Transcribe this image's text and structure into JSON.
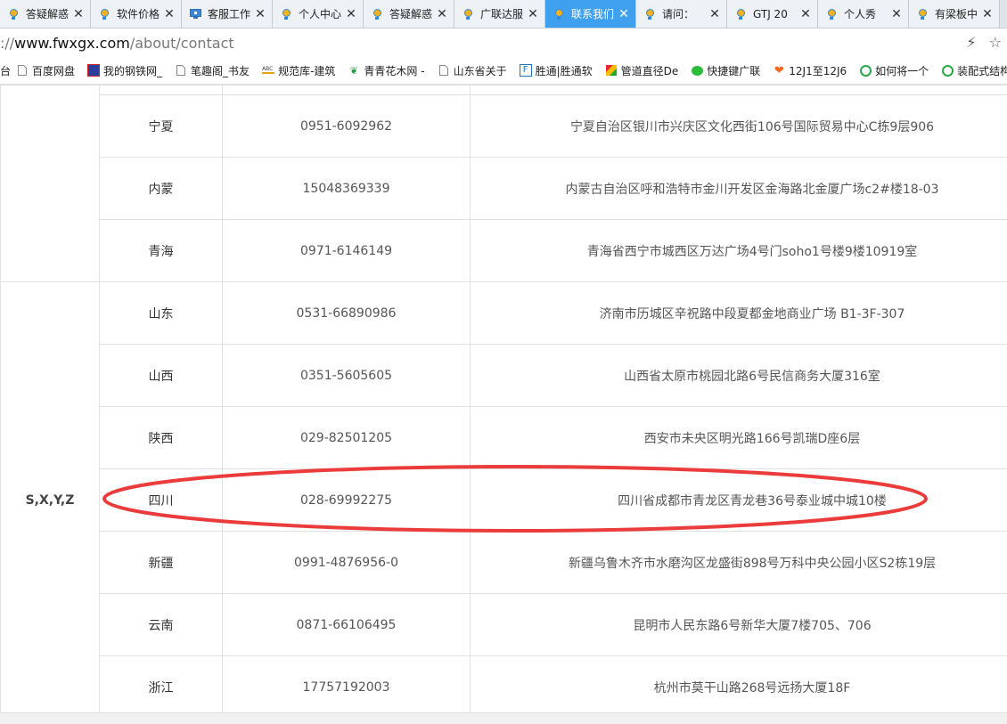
{
  "tabs": [
    {
      "label": "答疑解惑",
      "icon": "bulb-icon",
      "active": false
    },
    {
      "label": "软件价格",
      "icon": "bulb-icon",
      "active": false
    },
    {
      "label": "客服工作",
      "icon": "monitor-icon",
      "active": false
    },
    {
      "label": "个人中心",
      "icon": "bulb-icon",
      "active": false
    },
    {
      "label": "答疑解惑",
      "icon": "bulb-icon",
      "active": false
    },
    {
      "label": "广联达服",
      "icon": "bulb-icon",
      "active": false
    },
    {
      "label": "联系我们",
      "icon": "bulb-icon",
      "active": true
    },
    {
      "label": "请问：",
      "icon": "bulb-icon",
      "active": false
    },
    {
      "label": "GTJ 20",
      "icon": "bulb-icon",
      "active": false
    },
    {
      "label": "个人秀",
      "icon": "bulb-icon",
      "active": false
    },
    {
      "label": "有梁板中",
      "icon": "bulb-icon",
      "active": false
    }
  ],
  "address": {
    "scheme": "://",
    "domain": "www.fwxgx.com",
    "path": "/about/contact"
  },
  "bookmarks": [
    {
      "label": "台",
      "icon": ""
    },
    {
      "label": "百度网盘",
      "icon": "page-icon"
    },
    {
      "label": "我的钢铁网_",
      "icon": "steel-icon"
    },
    {
      "label": "笔趣阁_书友",
      "icon": "page-icon"
    },
    {
      "label": "规范库-建筑",
      "icon": "ruler-icon"
    },
    {
      "label": "青青花木网 -",
      "icon": "leaf-icon"
    },
    {
      "label": "山东省关于",
      "icon": "page-icon"
    },
    {
      "label": "胜通|胜通软",
      "icon": "f-icon"
    },
    {
      "label": "管道直径De",
      "icon": "puzzle-icon"
    },
    {
      "label": "快捷键广联",
      "icon": "wechat-icon"
    },
    {
      "label": "12J1至12J6",
      "icon": "heart-icon"
    },
    {
      "label": "如何将一个",
      "icon": "circle-icon"
    },
    {
      "label": "装配式结构",
      "icon": "circle-icon"
    }
  ],
  "groups": [
    {
      "name": "",
      "rows": [
        {
          "province": "",
          "phone": "",
          "address": ""
        },
        {
          "province": "宁夏",
          "phone": "0951-6092962",
          "address": "宁夏自治区银川市兴庆区文化西街106号国际贸易中心C栋9层906"
        },
        {
          "province": "内蒙",
          "phone": "15048369339",
          "address": "内蒙古自治区呼和浩特市金川开发区金海路北金厦广场c2#楼18-03"
        },
        {
          "province": "青海",
          "phone": "0971-6146149",
          "address": "青海省西宁市城西区万达广场4号门soho1号楼9楼10919室"
        }
      ]
    },
    {
      "name": "S,X,Y,Z",
      "rows": [
        {
          "province": "山东",
          "phone": "0531-66890986",
          "address": "济南市历城区辛祝路中段夏都金地商业广场 B1-3F-307"
        },
        {
          "province": "山西",
          "phone": "0351-5605605",
          "address": "山西省太原市桃园北路6号民信商务大厦316室"
        },
        {
          "province": "陕西",
          "phone": "029-82501205",
          "address": "西安市未央区明光路166号凯瑞D座6层"
        },
        {
          "province": "四川",
          "phone": "028-69992275",
          "address": "四川省成都市青龙区青龙巷36号泰业城中城10楼"
        },
        {
          "province": "新疆",
          "phone": "0991-4876956-0",
          "address": "新疆乌鲁木齐市水磨沟区龙盛街898号万科中央公园小区S2栋19层"
        },
        {
          "province": "云南",
          "phone": "0871-66106495",
          "address": "昆明市人民东路6号新华大厦7楼705、706"
        },
        {
          "province": "浙江",
          "phone": "17757192003",
          "address": "杭州市莫干山路268号远扬大厦18F"
        }
      ]
    }
  ],
  "annotation": {
    "color": "#ec3b3b"
  }
}
